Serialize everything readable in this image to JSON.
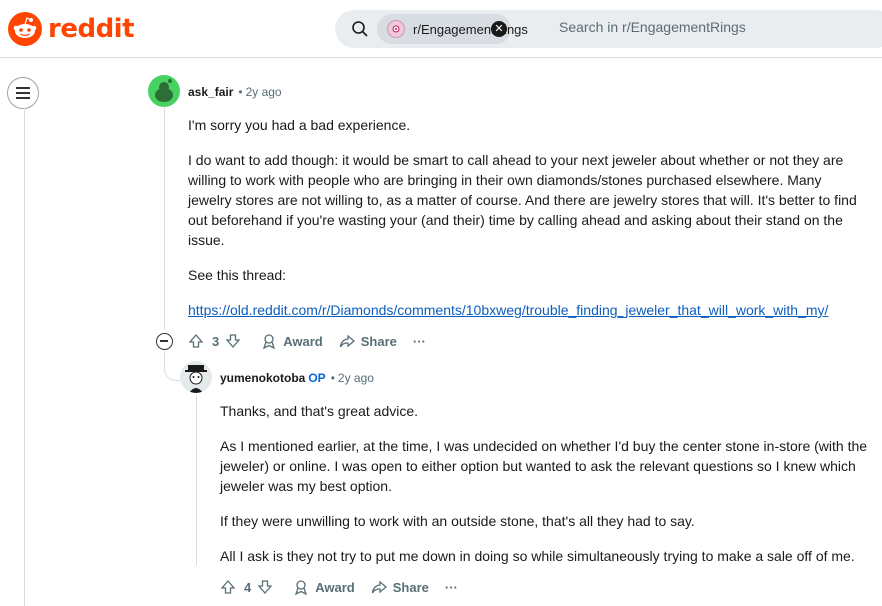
{
  "brand": {
    "name": "reddit",
    "color": "#ff4500"
  },
  "search": {
    "community_chip": "r/EngagementRings",
    "placeholder": "Search in r/EngagementRings"
  },
  "comments": [
    {
      "user": "ask_fair",
      "age": "2y ago",
      "paragraphs": [
        "I'm sorry you had a bad experience.",
        "I do want to add though: it would be smart to call ahead to your next jeweler about whether or not they are willing to work with people who are bringing in their own diamonds/stones purchased elsewhere. Many jewelry stores are not willing to, as a matter of course. And there are jewelry stores that will. It's better to find out beforehand if you're wasting your (and their) time by calling ahead and asking about their stand on the issue.",
        "See this thread:"
      ],
      "link": "https://old.reddit.com/r/Diamonds/comments/10bxweg/trouble_finding_jeweler_that_will_work_with_my/",
      "score": "3",
      "award_label": "Award",
      "share_label": "Share",
      "more_label": "···"
    },
    {
      "user": "yumenokotoba",
      "op_badge": "OP",
      "age": "2y ago",
      "paragraphs": [
        "Thanks, and that's great advice.",
        "As I mentioned earlier, at the time, I was undecided on whether I'd buy the center stone in-store (with the jeweler) or online. I was open to either option but wanted to ask the relevant questions so I knew which jeweler was my best option.",
        "If they were unwilling to work with an outside stone, that's all they had to say.",
        "All I ask is they not try to put me down in doing so while simultaneously trying to make a sale off of me."
      ],
      "score": "4",
      "award_label": "Award",
      "share_label": "Share",
      "more_label": "···"
    }
  ]
}
